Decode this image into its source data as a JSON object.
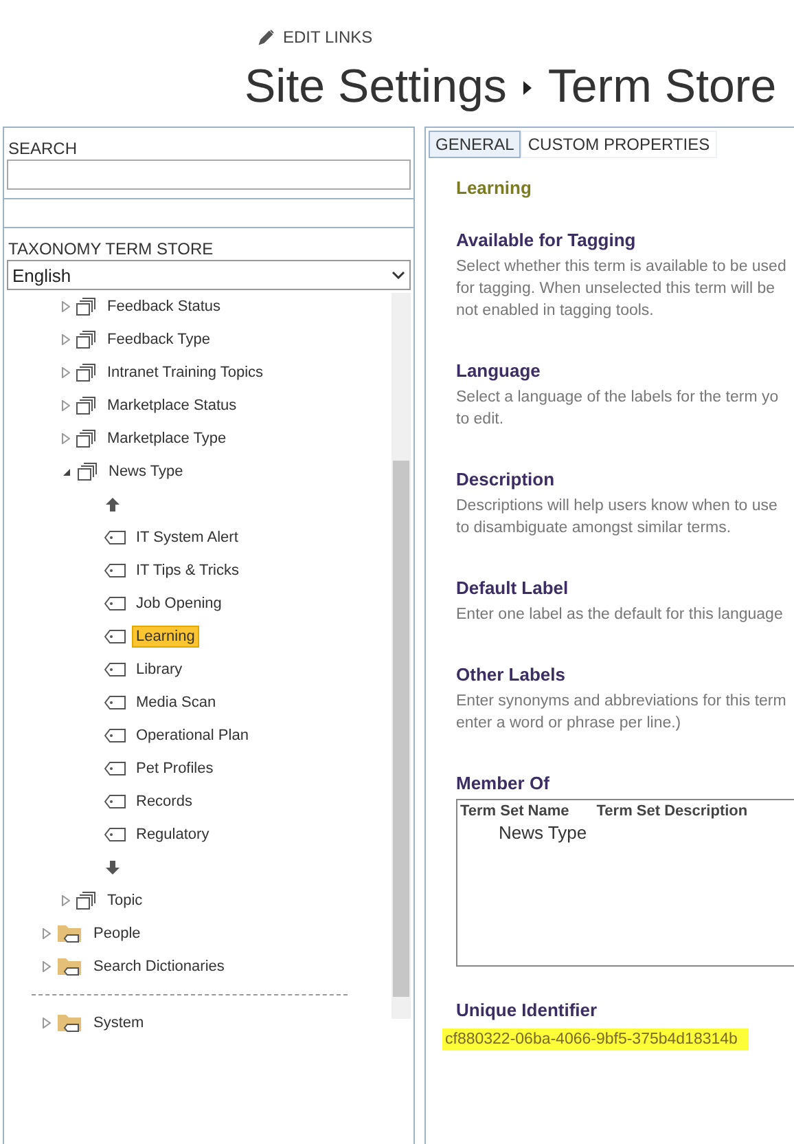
{
  "header": {
    "edit_links": "EDIT LINKS",
    "breadcrumb": [
      "Site Settings",
      "Term Store"
    ]
  },
  "search": {
    "label": "SEARCH"
  },
  "taxonomy": {
    "label": "TAXONOMY TERM STORE",
    "language": "English"
  },
  "tree": {
    "term_sets": [
      {
        "label": "Feedback Status",
        "expanded": false
      },
      {
        "label": "Feedback Type",
        "expanded": false
      },
      {
        "label": "Intranet Training Topics",
        "expanded": false
      },
      {
        "label": "Marketplace Status",
        "expanded": false
      },
      {
        "label": "Marketplace Type",
        "expanded": false
      },
      {
        "label": "News Type",
        "expanded": true,
        "children": [
          {
            "label": "IT System Alert",
            "selected": false
          },
          {
            "label": "IT Tips & Tricks",
            "selected": false
          },
          {
            "label": "Job Opening",
            "selected": false
          },
          {
            "label": "Learning",
            "selected": true
          },
          {
            "label": "Library",
            "selected": false
          },
          {
            "label": "Media Scan",
            "selected": false
          },
          {
            "label": "Operational Plan",
            "selected": false
          },
          {
            "label": "Pet Profiles",
            "selected": false
          },
          {
            "label": "Records",
            "selected": false
          },
          {
            "label": "Regulatory",
            "selected": false
          }
        ]
      },
      {
        "label": "Topic",
        "expanded": false
      }
    ],
    "groups": [
      {
        "label": "People",
        "expanded": false
      },
      {
        "label": "Search Dictionaries",
        "expanded": false
      }
    ],
    "system_groups": [
      {
        "label": "System",
        "expanded": false
      }
    ]
  },
  "tabs": [
    {
      "label": "GENERAL",
      "selected": true
    },
    {
      "label": "CUSTOM PROPERTIES",
      "selected": false
    }
  ],
  "term_title": "Learning",
  "sections": [
    {
      "heading": "Available for Tagging",
      "lines": [
        "Select whether this term is available to be used",
        "for tagging. When unselected this term will be",
        "not enabled in tagging tools."
      ]
    },
    {
      "heading": "Language",
      "lines": [
        "Select a language of the labels for the term yo",
        "to edit."
      ]
    },
    {
      "heading": "Description",
      "lines": [
        "Descriptions will help users know when to use",
        "to disambiguate amongst similar terms."
      ]
    },
    {
      "heading": "Default Label",
      "lines": [
        "Enter one label as the default for this language"
      ]
    },
    {
      "heading": "Other Labels",
      "lines": [
        "Enter synonyms and abbreviations for this term",
        "enter a word or phrase per line.)"
      ]
    }
  ],
  "member_of": {
    "heading": "Member Of",
    "columns": [
      "Term Set Name",
      "Term Set Description"
    ],
    "rows": [
      [
        "News Type"
      ]
    ]
  },
  "unique_identifier": {
    "heading": "Unique Identifier",
    "value": "cf880322-06ba-4066-9bf5-375b4d18314b"
  }
}
